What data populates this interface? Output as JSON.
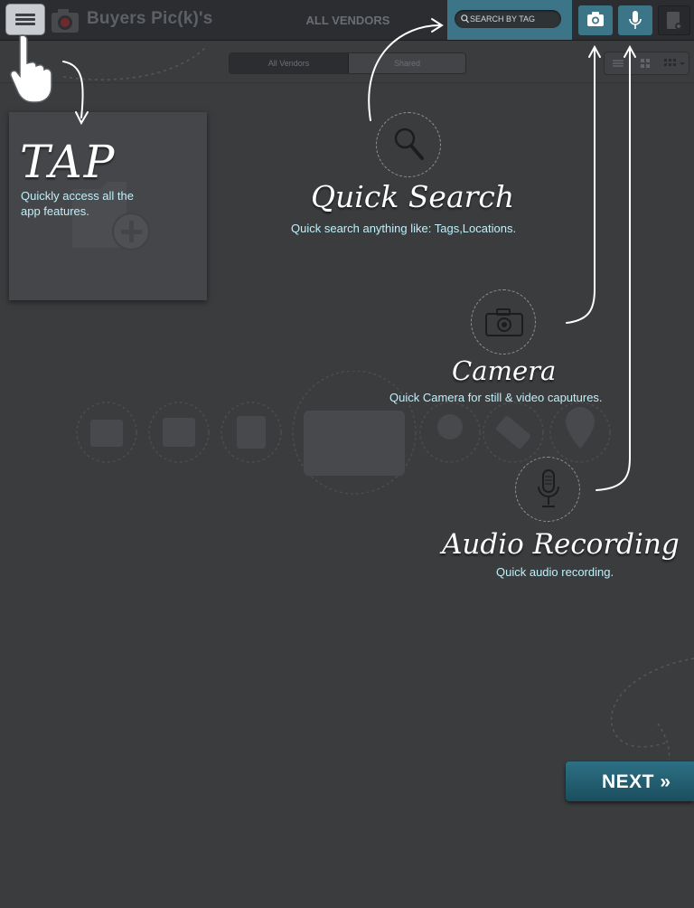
{
  "topbar": {
    "app_title": "Buyers Pic(k)'s",
    "vendors_title": "ALL VENDORS",
    "search_placeholder": "SEARCH BY TAG"
  },
  "segmented": {
    "tabs": [
      {
        "label": "All Vendors",
        "active": true
      },
      {
        "label": "Shared",
        "active": false
      }
    ]
  },
  "overlay": {
    "tap": {
      "title": "TAP",
      "description": "Quickly access all the app features."
    },
    "quick_search": {
      "title": "Quick Search",
      "description": "Quick search anything like: Tags,Locations."
    },
    "camera": {
      "title": "Camera",
      "description": "Quick Camera for still & video caputures."
    },
    "audio": {
      "title": "Audio Recording",
      "description": "Quick audio recording."
    },
    "next_label": "NEXT »"
  },
  "icons": [
    "menu-icon",
    "app-logo-icon",
    "search-icon",
    "camera-icon",
    "microphone-icon",
    "note-icon",
    "list-view-icon",
    "grid-view-icon",
    "tile-view-icon",
    "hand-pointer-icon",
    "add-folder-icon"
  ],
  "colors": {
    "accent": "#3b7587",
    "next_button": "#1f5c6f",
    "overlay_desc_text": "#bff0fb",
    "background": "#3b3c3e"
  }
}
